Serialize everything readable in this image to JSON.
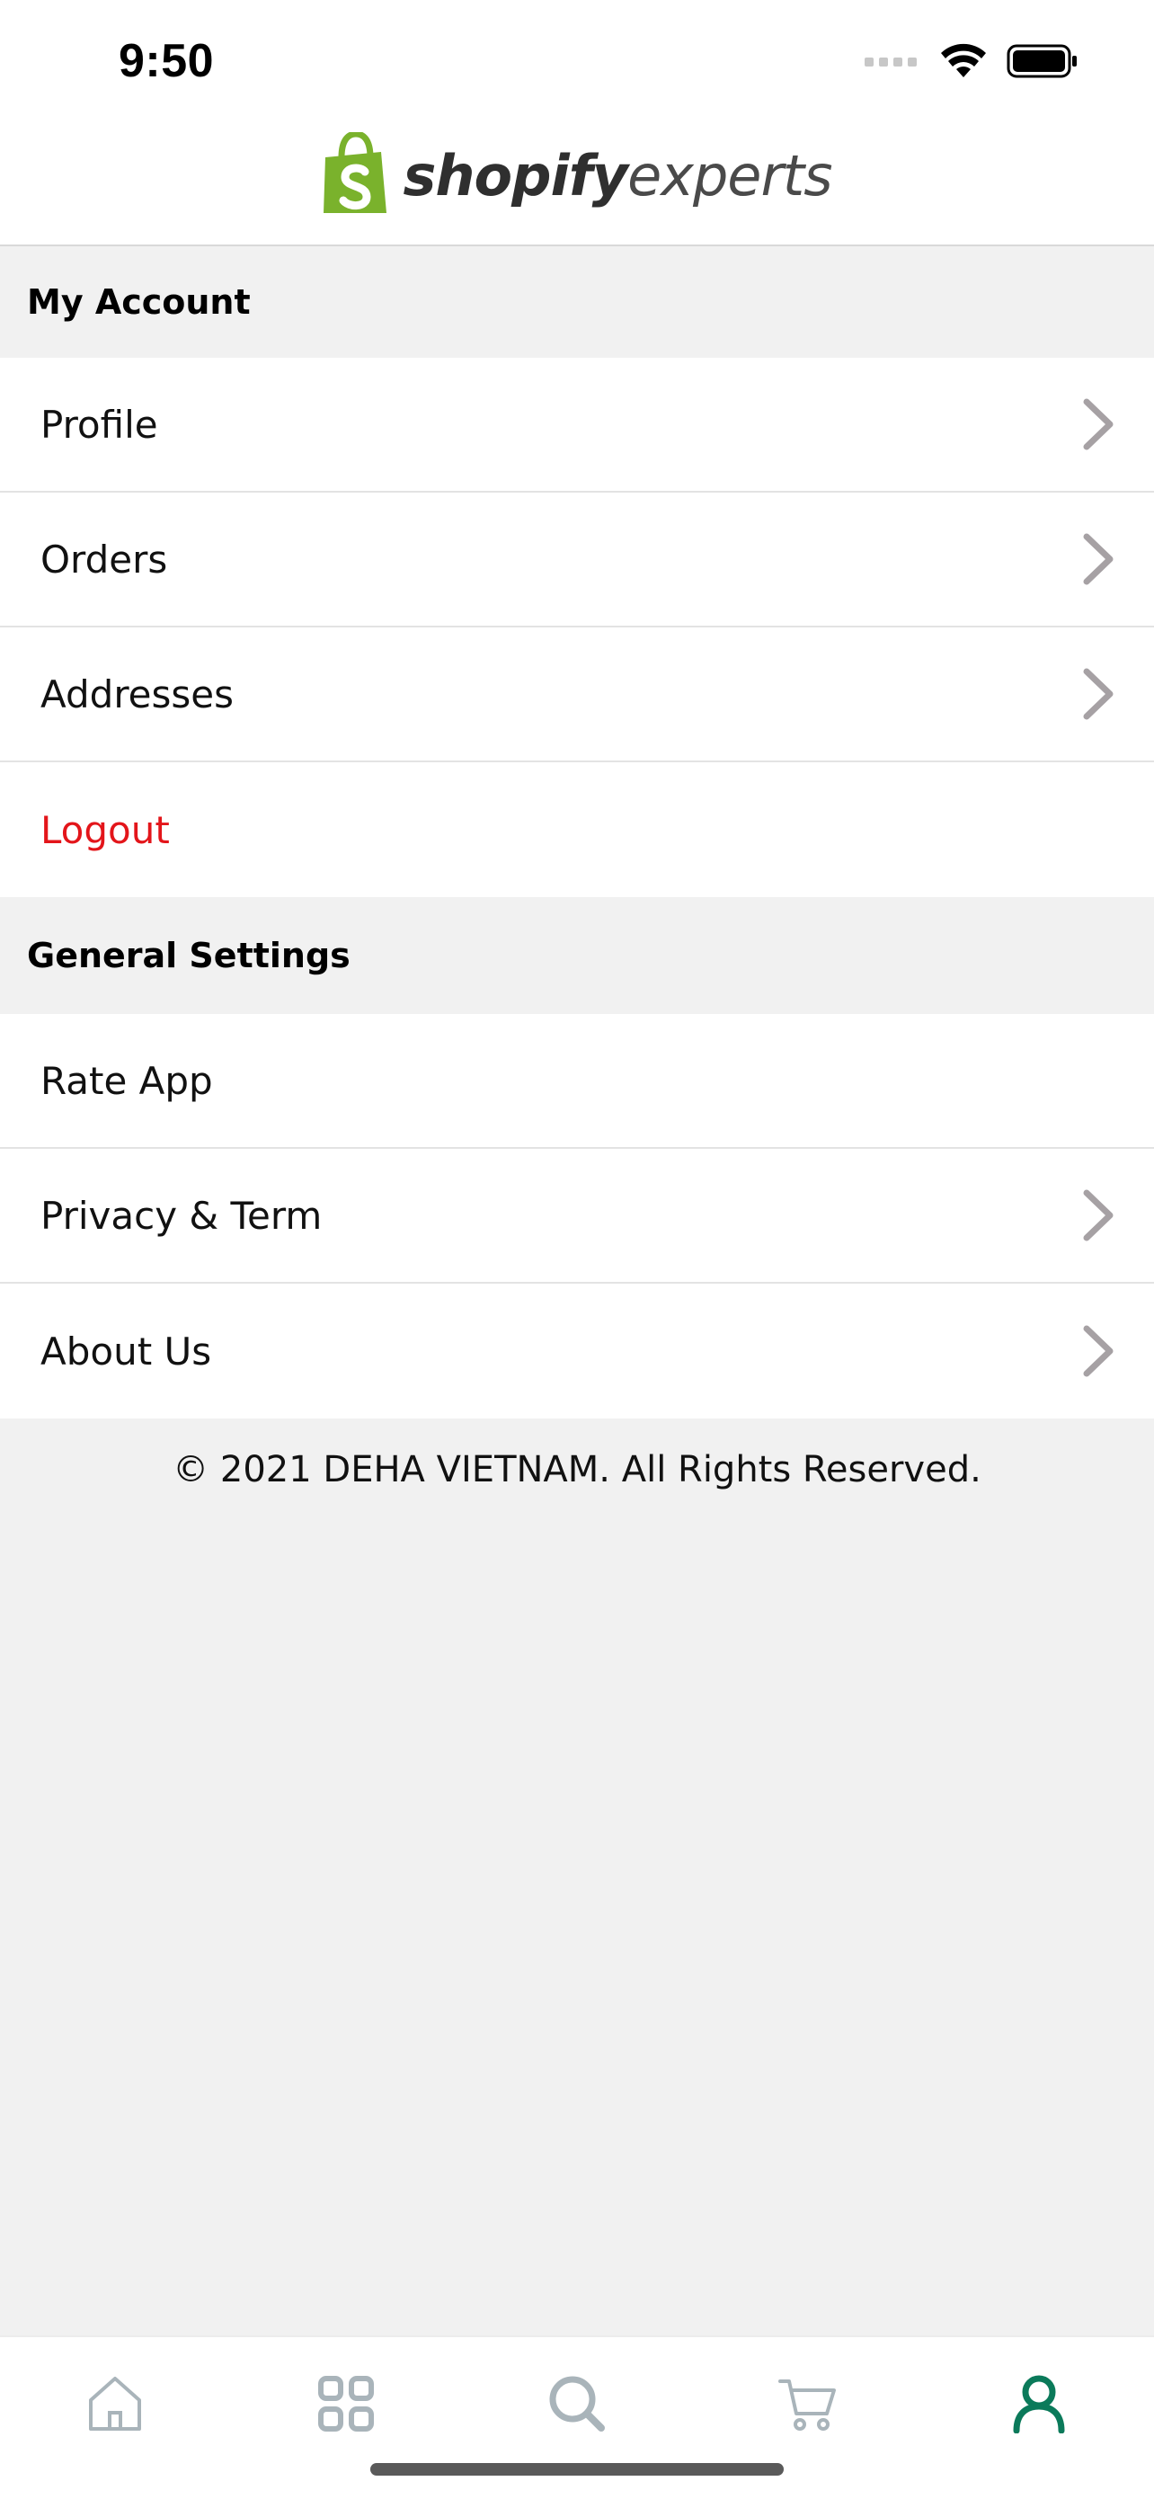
{
  "status_bar": {
    "time": "9:50",
    "icons": [
      "signal-icon",
      "wifi-icon",
      "battery-icon"
    ]
  },
  "header": {
    "logo_bold": "shopify",
    "logo_light": "experts",
    "logo_icon": "shopping-bag-icon"
  },
  "sections": {
    "account": {
      "title": "My Account",
      "items": [
        {
          "label": "Profile"
        },
        {
          "label": "Orders"
        },
        {
          "label": "Addresses"
        },
        {
          "label": "Logout"
        }
      ]
    },
    "general": {
      "title": "General Settings",
      "items": [
        {
          "label": "Rate App"
        },
        {
          "label": "Privacy & Term"
        },
        {
          "label": "About Us"
        }
      ]
    }
  },
  "footer": {
    "copyright": "© 2021 DEHA VIETNAM. All Rights Reserved."
  },
  "tabbar": {
    "tabs": [
      "home-icon",
      "categories-icon",
      "search-icon",
      "cart-icon",
      "account-icon"
    ],
    "active_color": "#0b7a5a",
    "inactive_color": "#a9b4ba"
  },
  "colors": {
    "logout": "#e3151a",
    "brand_green": "#7ab22c",
    "chevron": "#a6a1a4"
  }
}
